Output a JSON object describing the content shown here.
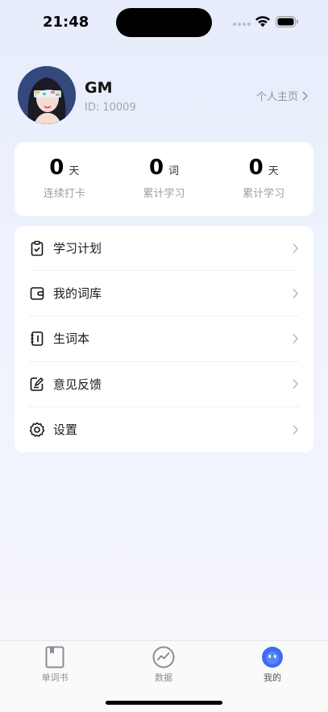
{
  "status_bar": {
    "time": "21:48"
  },
  "profile": {
    "name": "GM",
    "id_text": "ID: 10009",
    "link_label": "个人主页"
  },
  "stats": [
    {
      "value": "0",
      "unit": "天",
      "label": "连续打卡"
    },
    {
      "value": "0",
      "unit": "词",
      "label": "累计学习"
    },
    {
      "value": "0",
      "unit": "天",
      "label": "累计学习"
    }
  ],
  "menu": {
    "items": [
      {
        "label": "学习计划",
        "icon": "clipboard-check-icon"
      },
      {
        "label": "我的词库",
        "icon": "wallet-icon"
      },
      {
        "label": "生词本",
        "icon": "notebook-icon"
      },
      {
        "label": "意见反馈",
        "icon": "feedback-edit-icon"
      },
      {
        "label": "设置",
        "icon": "gear-icon"
      }
    ]
  },
  "tab_bar": {
    "tabs": [
      {
        "label": "单词书",
        "icon": "book-icon",
        "active": false
      },
      {
        "label": "数据",
        "icon": "chart-icon",
        "active": false
      },
      {
        "label": "我的",
        "icon": "mascot-icon",
        "active": true
      }
    ]
  },
  "colors": {
    "accent_blue": "#3a6df0",
    "text_primary": "#111111",
    "text_secondary": "#9a9ea6"
  }
}
